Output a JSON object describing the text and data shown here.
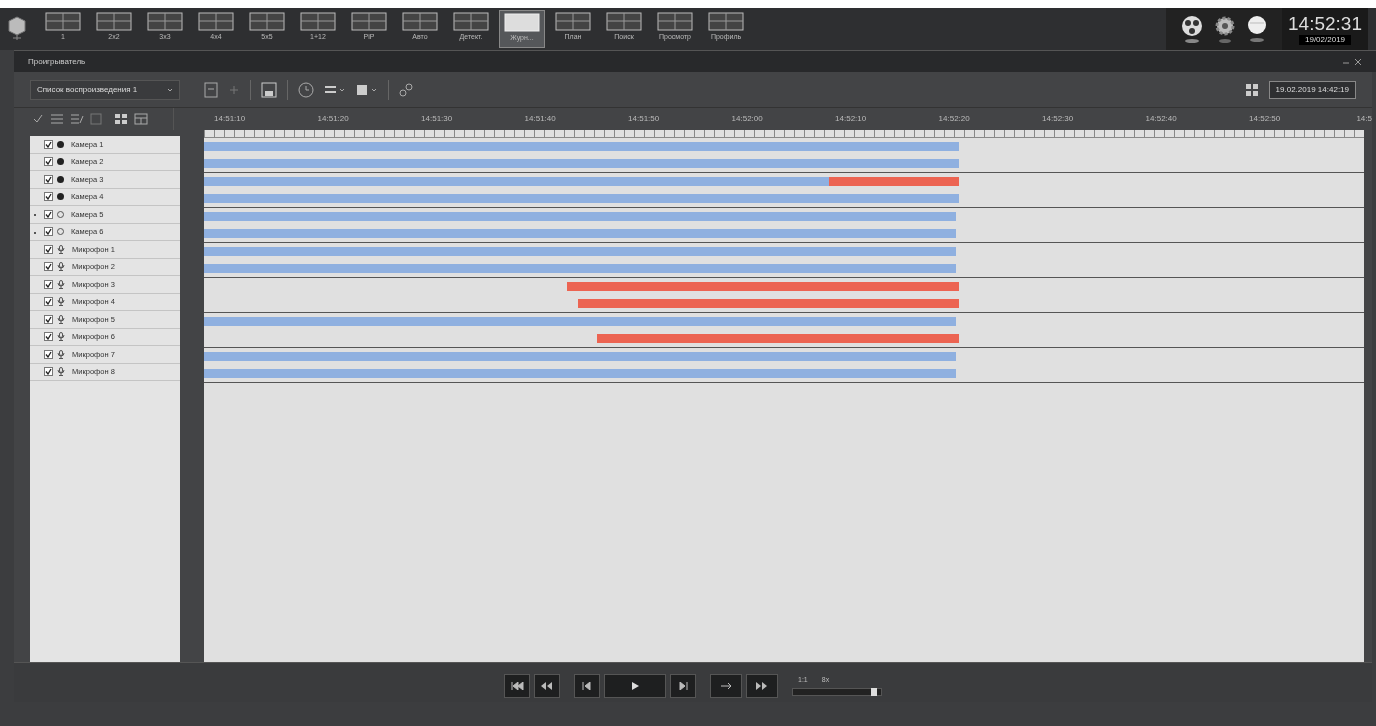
{
  "layouts": [
    {
      "label": "1",
      "selected": false
    },
    {
      "label": "2x2",
      "selected": false
    },
    {
      "label": "3x3",
      "selected": false
    },
    {
      "label": "4x4",
      "selected": false
    },
    {
      "label": "5x5",
      "selected": false
    },
    {
      "label": "1+12",
      "selected": false
    },
    {
      "label": "PiP",
      "selected": false
    },
    {
      "label": "Авто",
      "selected": false
    },
    {
      "label": "Детект.",
      "selected": false
    },
    {
      "label": "Журн...",
      "selected": true
    },
    {
      "label": "План",
      "selected": false
    },
    {
      "label": "Поиск",
      "selected": false
    },
    {
      "label": "Просмотр",
      "selected": false
    },
    {
      "label": "Профиль",
      "selected": false
    }
  ],
  "clock": {
    "time": "14:52:31",
    "date": "19/02/2019"
  },
  "window": {
    "title": "Проигрыватель"
  },
  "playlist": {
    "value": "Список воспроизведения 1"
  },
  "archive_time": "19.02.2019 14:42:19",
  "timeline": {
    "ticks": [
      "14:51:10",
      "14:51:20",
      "14:51:30",
      "14:51:40",
      "14:51:50",
      "14:52:00",
      "14:52:10",
      "14:52:20",
      "14:52:30",
      "14:52:40",
      "14:52:50",
      "14:5"
    ]
  },
  "channels": [
    {
      "name": "Камера 1",
      "kind": "camera",
      "active": true,
      "marked": false,
      "checked": true,
      "segments": [
        {
          "kind": "normal",
          "level": 0.651
        }
      ]
    },
    {
      "name": "Камера 2",
      "kind": "camera",
      "active": true,
      "marked": false,
      "checked": true,
      "segments": [
        {
          "kind": "normal",
          "level": 0.651
        }
      ]
    },
    {
      "name": "Камера 3",
      "kind": "camera",
      "active": true,
      "marked": false,
      "checked": true,
      "segments": [
        {
          "kind": "normal",
          "level": 0.539
        },
        {
          "kind": "alarm"
        }
      ]
    },
    {
      "name": "Камера 4",
      "kind": "camera",
      "active": true,
      "marked": false,
      "checked": true,
      "segments": [
        {
          "kind": "normal",
          "level": 0.651
        }
      ]
    },
    {
      "name": "Камера 5",
      "kind": "camera",
      "active": false,
      "marked": true,
      "checked": true,
      "segments": [
        {
          "kind": "normal",
          "level": 0.648
        }
      ]
    },
    {
      "name": "Камера 6",
      "kind": "camera",
      "active": false,
      "marked": true,
      "checked": true,
      "segments": [
        {
          "kind": "normal",
          "level": 0.648
        }
      ]
    },
    {
      "name": "Микрофон 1",
      "kind": "microphone",
      "marked": false,
      "checked": true,
      "segments": [
        {
          "kind": "normal",
          "level": 0.648
        }
      ]
    },
    {
      "name": "Микрофон 2",
      "kind": "microphone",
      "marked": false,
      "checked": true,
      "segments": [
        {
          "kind": "normal",
          "level": 0.648
        }
      ]
    },
    {
      "name": "Микрофон 3",
      "kind": "microphone",
      "marked": false,
      "checked": true,
      "segments": [
        {
          "kind": "alarm"
        }
      ]
    },
    {
      "name": "Микрофон 4",
      "kind": "microphone",
      "marked": false,
      "checked": true,
      "segments": [
        {
          "kind": "alarm"
        }
      ]
    },
    {
      "name": "Микрофон 5",
      "kind": "microphone",
      "marked": false,
      "checked": true,
      "segments": [
        {
          "kind": "normal",
          "level": 0.648
        }
      ]
    },
    {
      "name": "Микрофон 6",
      "kind": "microphone",
      "marked": false,
      "checked": true,
      "segments": [
        {
          "kind": "alarm"
        }
      ]
    },
    {
      "name": "Микрофон 7",
      "kind": "microphone",
      "marked": false,
      "checked": true,
      "segments": [
        {
          "kind": "normal",
          "level": 0.648
        }
      ]
    },
    {
      "name": "Микрофон 8",
      "kind": "microphone",
      "marked": false,
      "checked": true,
      "segments": [
        {
          "kind": "normal",
          "level": 0.648
        }
      ]
    }
  ],
  "speed": {
    "labels": [
      "1:1",
      "8x"
    ],
    "level": 0.95
  }
}
